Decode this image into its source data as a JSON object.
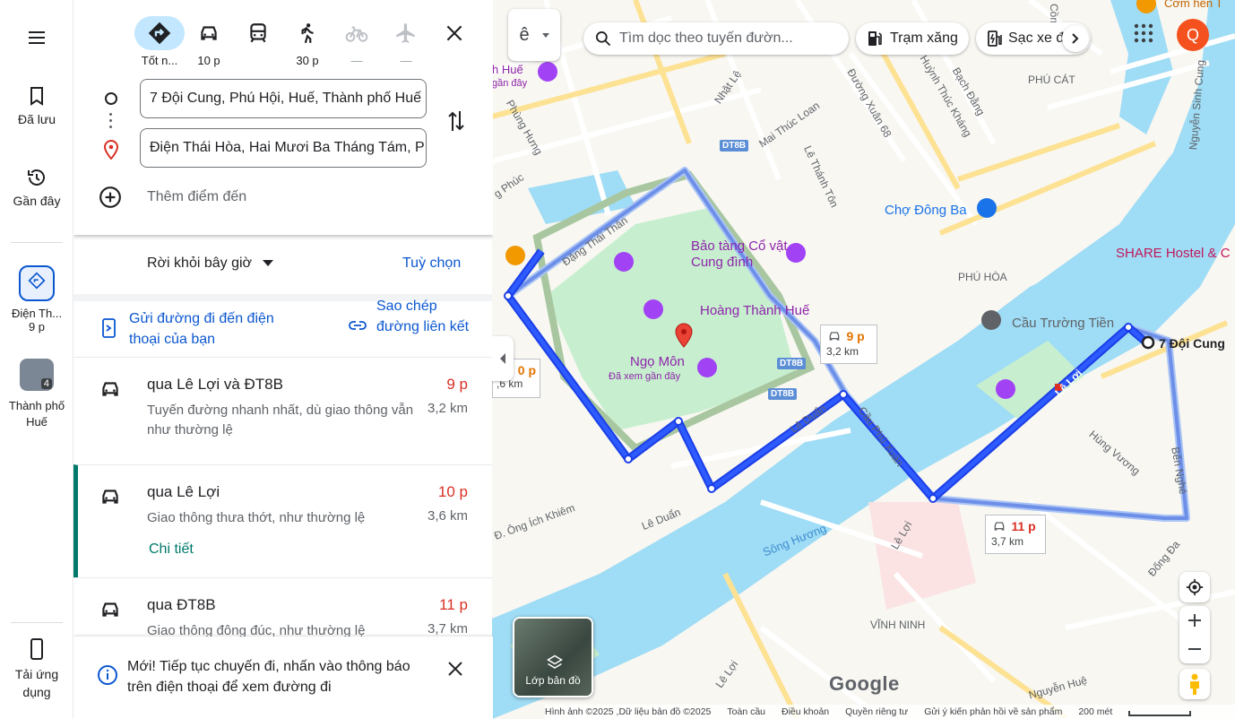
{
  "rail": {
    "saved_label": "Đã lưu",
    "recent_label": "Gần đây",
    "recent_item1_label": "Điện Th...",
    "recent_item1_sub": "9 p",
    "recent_item2_label": "Thành phố Huế",
    "recent_item2_badge": "4",
    "app_label": "Tải ứng dụng"
  },
  "modes": [
    {
      "label": "Tốt n...",
      "icon": "directions-icon"
    },
    {
      "label": "10 p",
      "icon": "car-icon"
    },
    {
      "label": "",
      "icon": "transit-icon"
    },
    {
      "label": "30 p",
      "icon": "walk-icon"
    },
    {
      "label": "—",
      "icon": "bike-icon"
    },
    {
      "label": "—",
      "icon": "flight-icon"
    }
  ],
  "origin": "7 Đội Cung, Phú Hội, Huế, Thành phố Huế",
  "destination": "Điện Thái Hòa, Hai Mươi Ba Tháng Tám, P",
  "add_destination": "Thêm điểm đến",
  "depart_label": "Rời khỏi bây giờ",
  "options_label": "Tuỳ chọn",
  "send_to_phone": "Gửi đường đi đến điện thoại của bạn",
  "copy_link": "Sao chép đường liên kết",
  "routes": [
    {
      "name": "qua Lê Lợi và ĐT8B",
      "desc": "Tuyến đường nhanh nhất, dù giao thông vẫn như thường lệ",
      "time": "9 p",
      "dist": "3,2 km"
    },
    {
      "name": "qua Lê Lợi",
      "desc": "Giao thông thưa thớt, như thường lệ",
      "time": "10 p",
      "dist": "3,6 km",
      "details": "Chi tiết"
    },
    {
      "name": "qua ĐT8B",
      "desc": "Giao thông đông đúc, như thường lệ",
      "time": "11 p",
      "dist": "3,7 km"
    }
  ],
  "toast": "Mới! Tiếp tục chuyến đi, nhấn vào thông báo trên điện thoại để xem đường đi",
  "map": {
    "search_placeholder": "Tìm dọc theo tuyến đườn...",
    "chip_gas": "Trạm xăng",
    "chip_charge": "Sạc xe đ",
    "avatar": "Q",
    "layers_label": "Lớp bản đồ",
    "google": "Google",
    "callout1_time": "9 p",
    "callout1_dist": "3,2 km",
    "callout2_time": "11 p",
    "callout2_dist": "3,7 km",
    "callout3_time": "0 p",
    "callout3_dist": ",6 km",
    "origin_label": "7 Đội Cung",
    "labels": {
      "hoang_thanh": "Hoàng Thành Huế",
      "ngo_mon": "Ngọ Môn",
      "ngo_mon_sub": "Đã xem gần đây",
      "bao_tang": "Bảo tàng Cổ vật Cung đình",
      "cho_dong_ba": "Chợ Đông Ba",
      "cau_truong_tien": "Cầu Trường Tiền",
      "share_hostel": "SHARE Hostel & C",
      "song_huong": "Sông Hương",
      "phu_cat": "PHÚ CÁT",
      "phu_hoa": "PHÚ HÒA",
      "vinh_ninh": "VĨNH NINH",
      "le_loi": "Lê Lợi",
      "le_duan": "Lê Duẩn",
      "cau_phu_xuan": "Cầu Phú Xuân",
      "hung_vuong": "Hùng Vương",
      "ben_nghe": "Bến Nghé",
      "dong_da": "Đống Đa",
      "nguyen_hue": "Nguyễn Huệ",
      "dang_thai_than": "Đặng Thái Thân",
      "mai_thuc_loan": "Mai Thúc Loan",
      "nhat_le": "Nhật Lệ",
      "huynh_thuc_khang": "Huỳnh Thúc Kháng",
      "bach_dang": "Bạch Đằng",
      "duong_xuan_68": "Đường Xuân 68",
      "le_thanh_ton": "Lê Thánh Tôn",
      "nguyen_sinh_cung": "Nguyễn Sinh Cung",
      "ong_ich_khiem": "Đ. Ông Ích Khiêm",
      "phung_hung": "Phùng Hưng",
      "dt8b": "DT8B",
      "hue_top": "h Huế",
      "hue_top_sub": "gần đây",
      "com_hen": "Cơm hến T",
      "con": "Cồn",
      "phuc": "g Phúc"
    },
    "footer": [
      "Hình ảnh ©2025 ,Dữ liệu bản đồ ©2025",
      "Toàn cầu",
      "Điều khoản",
      "Quyền riêng tư",
      "Gửi ý kiến phản hồi về sản phẩm",
      "200 mét"
    ]
  }
}
